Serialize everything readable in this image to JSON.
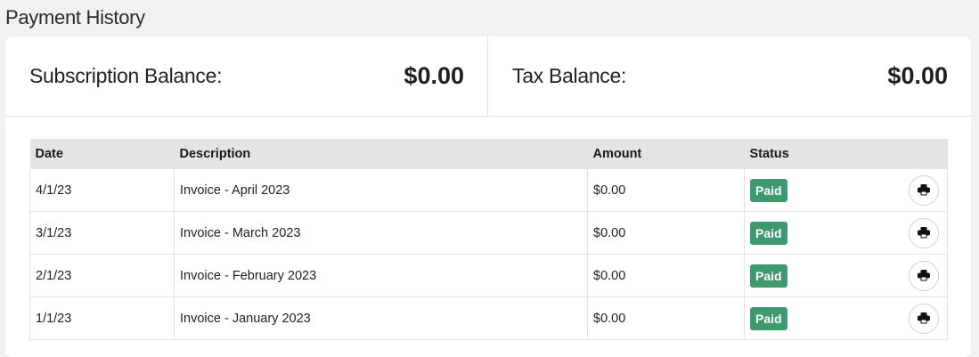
{
  "page": {
    "title": "Payment History"
  },
  "balances": {
    "subscription_label": "Subscription Balance:",
    "subscription_value": "$0.00",
    "tax_label": "Tax Balance:",
    "tax_value": "$0.00"
  },
  "table": {
    "headers": [
      "Date",
      "Description",
      "Amount",
      "Status"
    ],
    "rows": [
      {
        "date": "4/1/23",
        "description": "Invoice - April 2023",
        "amount": "$0.00",
        "status": "Paid"
      },
      {
        "date": "3/1/23",
        "description": "Invoice - March 2023",
        "amount": "$0.00",
        "status": "Paid"
      },
      {
        "date": "2/1/23",
        "description": "Invoice - February 2023",
        "amount": "$0.00",
        "status": "Paid"
      },
      {
        "date": "1/1/23",
        "description": "Invoice - January 2023",
        "amount": "$0.00",
        "status": "Paid"
      }
    ],
    "row_icon": "printer-icon"
  },
  "colors": {
    "paid_badge": "#3f9970",
    "header_bg": "#e4e4e4",
    "page_bg": "#f1f1f1"
  }
}
